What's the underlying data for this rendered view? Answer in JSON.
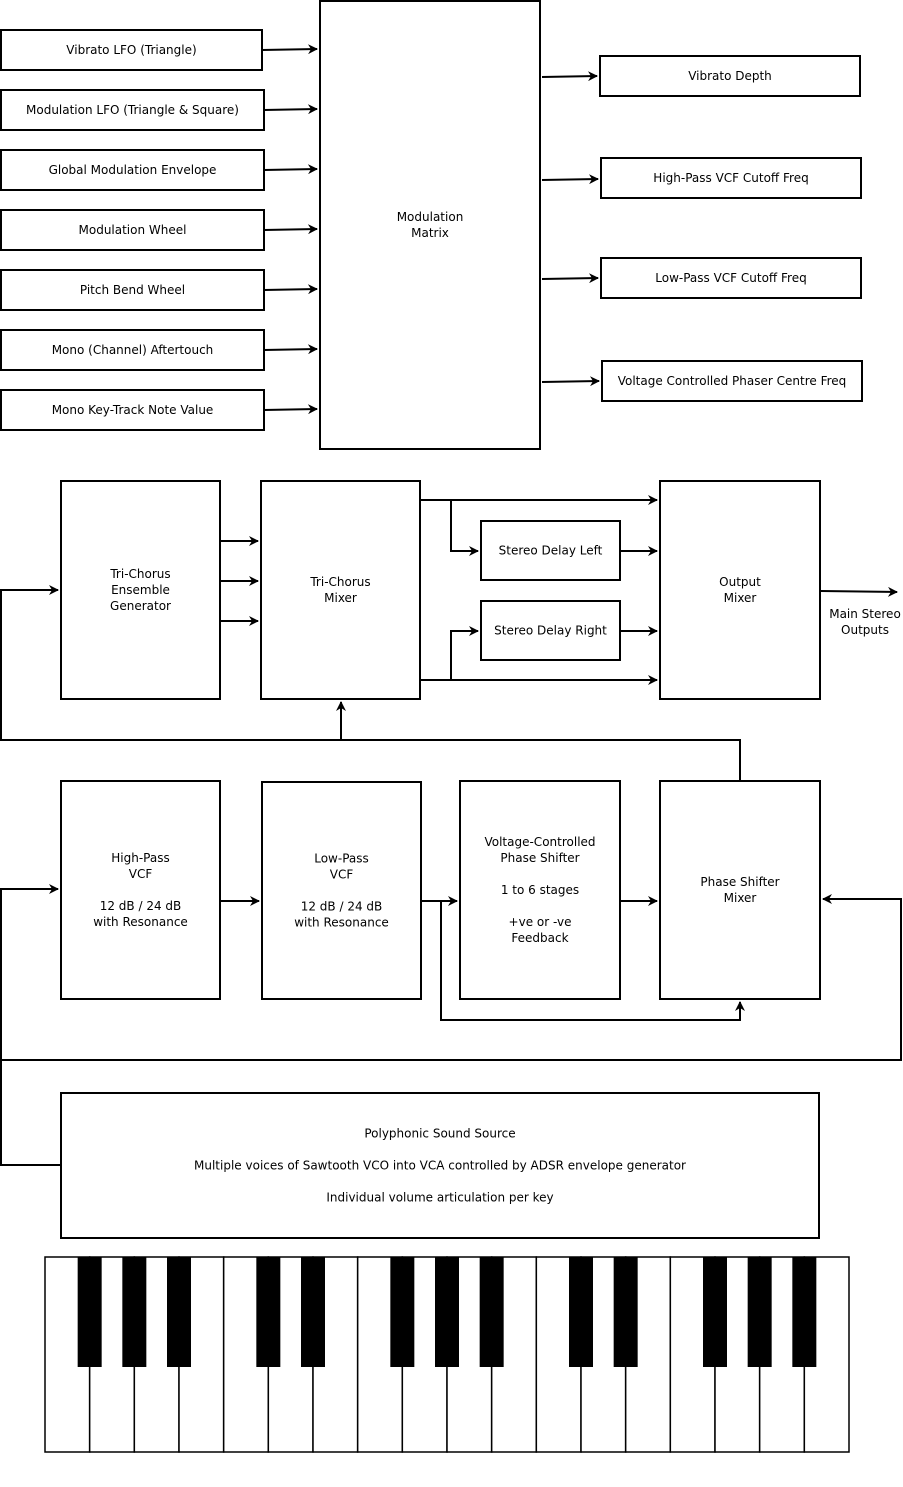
{
  "modulation_sources": [
    "Vibrato LFO (Triangle)",
    "Modulation LFO (Triangle & Square)",
    "Global Modulation Envelope",
    "Modulation Wheel",
    "Pitch Bend Wheel",
    "Mono (Channel) Aftertouch",
    "Mono Key-Track Note Value"
  ],
  "modulation_matrix": [
    "Modulation",
    "Matrix"
  ],
  "modulation_destinations": [
    "Vibrato Depth",
    "High-Pass VCF Cutoff Freq",
    "Low-Pass VCF Cutoff Freq",
    "Voltage Controlled Phaser Centre Freq"
  ],
  "effects": {
    "tri_chorus_generator": [
      "Tri-Chorus",
      "Ensemble",
      "Generator"
    ],
    "tri_chorus_mixer": [
      "Tri-Chorus",
      "Mixer"
    ],
    "stereo_delay_left": [
      "Stereo Delay Left"
    ],
    "stereo_delay_right": [
      "Stereo Delay Right"
    ],
    "output_mixer": [
      "Output",
      "Mixer"
    ],
    "main_outputs": [
      "Main Stereo",
      "Outputs"
    ]
  },
  "filters": {
    "high_pass": [
      "High-Pass",
      "VCF",
      "",
      "12 dB / 24 dB",
      "with Resonance"
    ],
    "low_pass": [
      "Low-Pass",
      "VCF",
      "",
      "12 dB / 24 dB",
      "with Resonance"
    ],
    "phase_shifter": [
      "Voltage-Controlled",
      "Phase Shifter",
      "",
      "1 to 6 stages",
      "",
      "+ve or -ve",
      "Feedback"
    ],
    "phase_mixer": [
      "Phase Shifter",
      "Mixer"
    ]
  },
  "sound_source": [
    "Polyphonic Sound Source",
    "",
    "Multiple voices of Sawtooth VCO into VCA controlled by ADSR envelope generator",
    "",
    "Individual volume articulation per key"
  ],
  "keyboard": {
    "white_keys": 18,
    "black_keys": 13
  }
}
